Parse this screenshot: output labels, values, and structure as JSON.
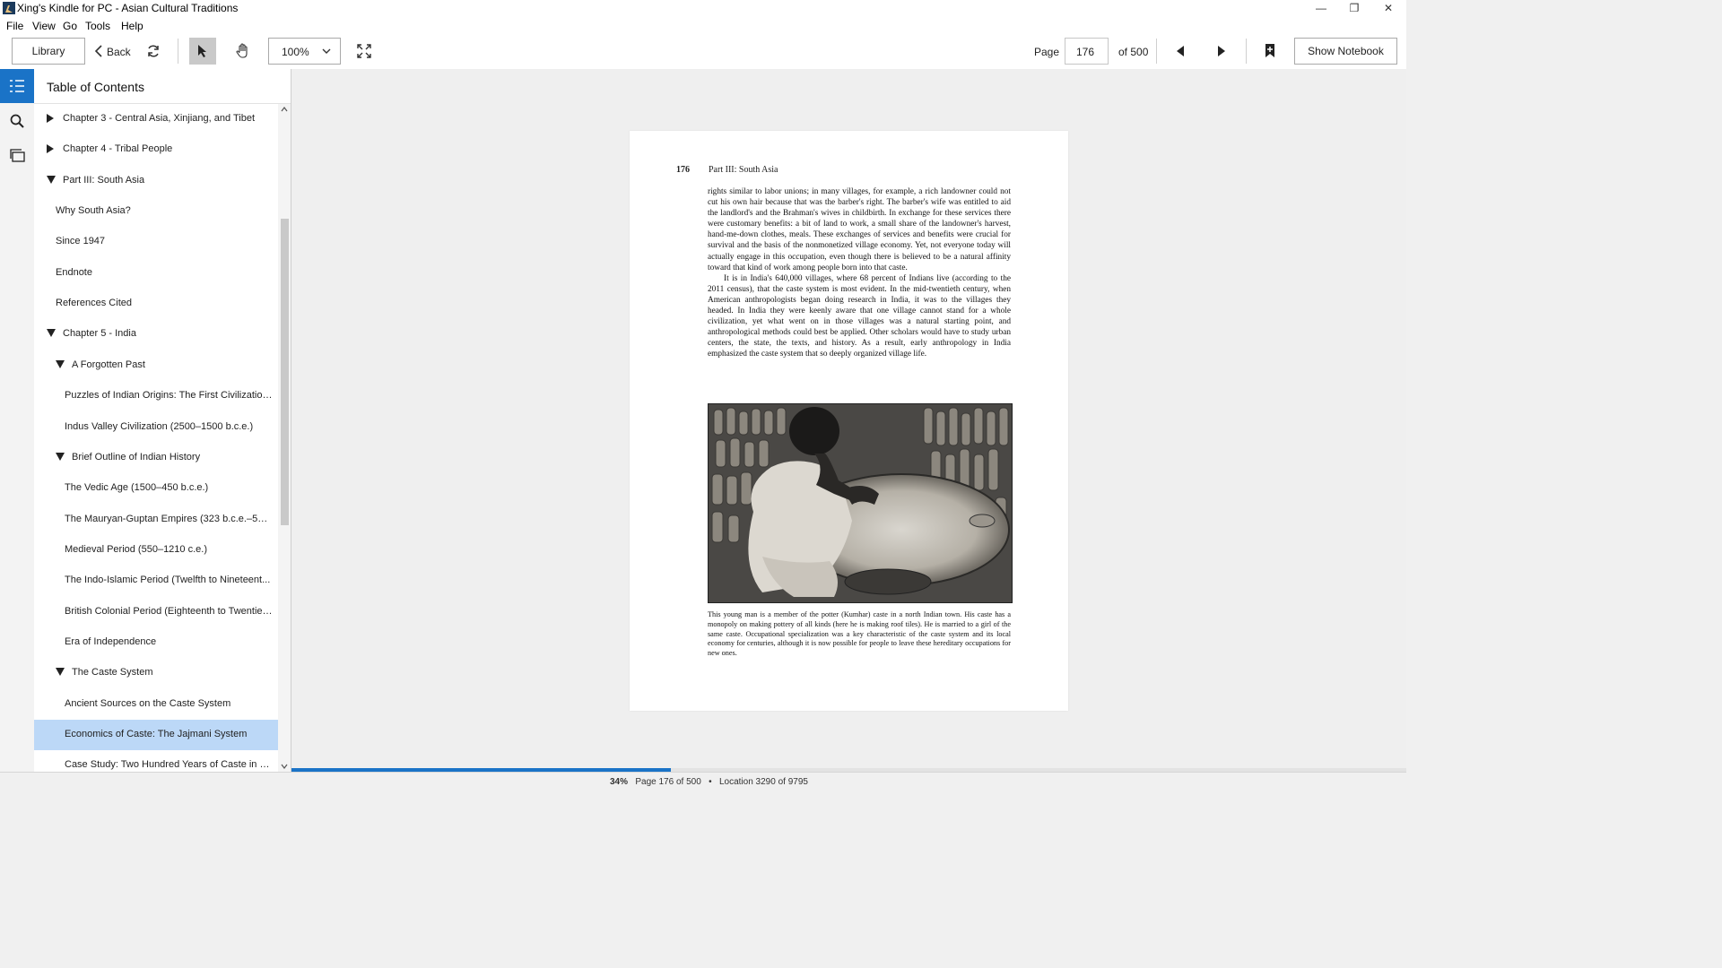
{
  "window": {
    "title": "Xing's Kindle for PC - Asian Cultural Traditions",
    "minimize_glyph": "—",
    "restore_glyph": "❐",
    "close_glyph": "✕"
  },
  "menu": [
    "File",
    "View",
    "Go",
    "Tools",
    "Help"
  ],
  "toolbar": {
    "library_label": "Library",
    "back_label": "Back",
    "zoom_value": "100%",
    "page_label": "Page",
    "page_input": "176",
    "of_label": "of 500",
    "notebook_label": "Show Notebook"
  },
  "toc": {
    "title": "Table of Contents",
    "items": [
      {
        "label": "Chapter 3 - Central Asia, Xinjiang, and Tibet",
        "level": 0,
        "toggle": "collapsed"
      },
      {
        "label": "Chapter 4 - Tribal People",
        "level": 0,
        "toggle": "collapsed"
      },
      {
        "label": "Part III: South Asia",
        "level": 0,
        "toggle": "expanded"
      },
      {
        "label": "Why South Asia?",
        "level": 1,
        "toggle": "none"
      },
      {
        "label": "Since 1947",
        "level": 1,
        "toggle": "none"
      },
      {
        "label": "Endnote",
        "level": 1,
        "toggle": "none"
      },
      {
        "label": "References Cited",
        "level": 1,
        "toggle": "none"
      },
      {
        "label": "Chapter 5 - India",
        "level": 0,
        "toggle": "expanded"
      },
      {
        "label": "A Forgotten Past",
        "level": 1,
        "toggle": "expanded"
      },
      {
        "label": "Puzzles of Indian Origins: The First Civilizations",
        "level": 2,
        "toggle": "none"
      },
      {
        "label": "Indus Valley Civilization (2500–1500 b.c.e.)",
        "level": 2,
        "toggle": "none"
      },
      {
        "label": "Brief Outline of Indian History",
        "level": 1,
        "toggle": "expanded"
      },
      {
        "label": "The Vedic Age (1500–450 b.c.e.)",
        "level": 2,
        "toggle": "none"
      },
      {
        "label": "The Mauryan-Guptan Empires (323 b.c.e.–550...",
        "level": 2,
        "toggle": "none"
      },
      {
        "label": "Medieval Period (550–1210 c.e.)",
        "level": 2,
        "toggle": "none"
      },
      {
        "label": "The Indo-Islamic Period (Twelfth to Nineteent...",
        "level": 2,
        "toggle": "none"
      },
      {
        "label": "British Colonial Period (Eighteenth to Twentiet...",
        "level": 2,
        "toggle": "none"
      },
      {
        "label": "Era of Independence",
        "level": 2,
        "toggle": "none"
      },
      {
        "label": "The Caste System",
        "level": 1,
        "toggle": "expanded"
      },
      {
        "label": "Ancient Sources on the Caste System",
        "level": 2,
        "toggle": "none"
      },
      {
        "label": "Economics of Caste: The Jajmani System",
        "level": 2,
        "toggle": "none",
        "selected": true
      },
      {
        "label": "Case Study: Two Hundred Years of Caste in a ...",
        "level": 2,
        "toggle": "none"
      }
    ]
  },
  "page": {
    "number": "176",
    "running_head": "Part III: South Asia",
    "paragraphs": [
      "rights similar to labor unions; in many villages, for example, a rich landowner could not cut his own hair because that was the barber's right. The barber's wife was entitled to aid the landlord's and the Brahman's wives in childbirth. In exchange for these services there were customary benefits: a bit of land to work, a small share of the landowner's harvest, hand-me-down clothes, meals. These exchanges of services and benefits were crucial for survival and the basis of the nonmonetized village economy. Yet, not everyone today will actually engage in this occupation, even though there is believed to be a natural affinity toward that kind of work among people born into that caste.",
      "It is in India's 640,000 villages, where 68 percent of Indians live (according to the 2011 census), that the caste system is most evident. In the mid-twentieth century, when American anthropologists began doing research in India, it was to the villages they headed. In India they were keenly aware that one village cannot stand for a whole civilization, yet what went on in those villages was a natural starting point, and anthropological methods could best be applied. Other scholars would have to study urban centers, the state, the texts, and history. As a result, early anthropology in India emphasized the caste system that so deeply organized village life."
    ],
    "caption": "This young man is a member of the potter (Kumhar) caste in a north Indian town. His caste has a monopoly on making pottery of all kinds (here he is making roof tiles). He is married to a girl of the same caste. Occupational specialization was a key characteristic of the caste system and its local economy for centuries, although it is now possible for people to leave these hereditary occupations for new ones."
  },
  "progress": {
    "fraction": 0.34
  },
  "status": {
    "percent": "34%",
    "page_info": "Page 176 of 500",
    "bullet": "•",
    "location": "Location 3290 of 9795"
  },
  "colors": {
    "accent": "#1a73c7",
    "selection": "#bcd8f7"
  }
}
